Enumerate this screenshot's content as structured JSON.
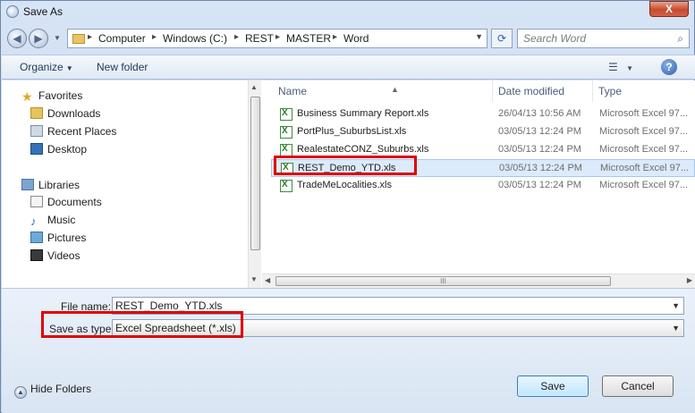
{
  "window": {
    "title": "Save As",
    "close_symbol": "X"
  },
  "nav": {
    "back_symbol": "◀",
    "forward_symbol": "▶",
    "breadcrumbs": [
      "Computer",
      "Windows (C:)",
      "REST",
      "MASTER",
      "Word"
    ],
    "search_placeholder": "Search Word"
  },
  "toolbar": {
    "organize_label": "Organize",
    "new_folder_label": "New folder"
  },
  "sidebar": {
    "favorites_label": "Favorites",
    "favorites": [
      "Downloads",
      "Recent Places",
      "Desktop"
    ],
    "libraries_label": "Libraries",
    "libraries": [
      "Documents",
      "Music",
      "Pictures",
      "Videos"
    ]
  },
  "columns": {
    "name": "Name",
    "date": "Date modified",
    "type": "Type"
  },
  "files": [
    {
      "name": "Business Summary Report.xls",
      "date": "26/04/13 10:56 AM",
      "type": "Microsoft Excel 97..."
    },
    {
      "name": "PortPlus_SuburbsList.xls",
      "date": "03/05/13 12:24 PM",
      "type": "Microsoft Excel 97..."
    },
    {
      "name": "RealestateCONZ_Suburbs.xls",
      "date": "03/05/13 12:24 PM",
      "type": "Microsoft Excel 97..."
    },
    {
      "name": "REST_Demo_YTD.xls",
      "date": "03/05/13 12:24 PM",
      "type": "Microsoft Excel 97..."
    },
    {
      "name": "TradeMeLocalities.xls",
      "date": "03/05/13 12:24 PM",
      "type": "Microsoft Excel 97..."
    }
  ],
  "form": {
    "file_name_label": "File name:",
    "file_name_value": "REST_Demo_YTD.xls",
    "save_type_label": "Save as type:",
    "save_type_value": "Excel Spreadsheet (*.xls)"
  },
  "footer": {
    "hide_folders_label": "Hide Folders",
    "save_label": "Save",
    "cancel_label": "Cancel"
  },
  "colors": {
    "highlight": "#e00000",
    "selection": "#dcebfc"
  }
}
